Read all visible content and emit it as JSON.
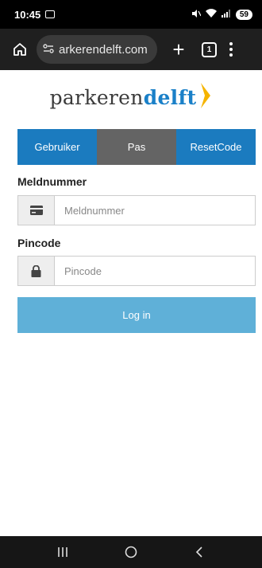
{
  "status_bar": {
    "time": "10:45",
    "battery": "59",
    "icons": [
      "screenshot-notification-icon",
      "mute-icon",
      "wifi-icon",
      "signal-icon",
      "battery-icon"
    ]
  },
  "browser": {
    "url": "arkerendelft.com",
    "tab_count": "1",
    "icons": [
      "home-icon",
      "site-settings-icon",
      "new-tab-icon",
      "tab-switcher-icon",
      "more-options-icon"
    ]
  },
  "logo": {
    "part1": "parkeren",
    "part2": "delft",
    "accent_color": "#1a80c8",
    "chevron_color": "#f5b400"
  },
  "tabs": [
    {
      "label": "Gebruiker",
      "active": false
    },
    {
      "label": "Pas",
      "active": true
    },
    {
      "label": "ResetCode",
      "active": false
    }
  ],
  "form": {
    "meldnummer": {
      "label": "Meldnummer",
      "placeholder": "Meldnummer",
      "value": "",
      "icon": "card-icon"
    },
    "pincode": {
      "label": "Pincode",
      "placeholder": "Pincode",
      "value": "",
      "icon": "lock-icon"
    },
    "submit_label": "Log in"
  },
  "nav_bar": {
    "icons": [
      "recent-apps-icon",
      "home-circle-icon",
      "back-icon"
    ]
  },
  "colors": {
    "tab_blue": "#1b7bbf",
    "tab_active": "#646464",
    "button": "#5fb0d8"
  }
}
